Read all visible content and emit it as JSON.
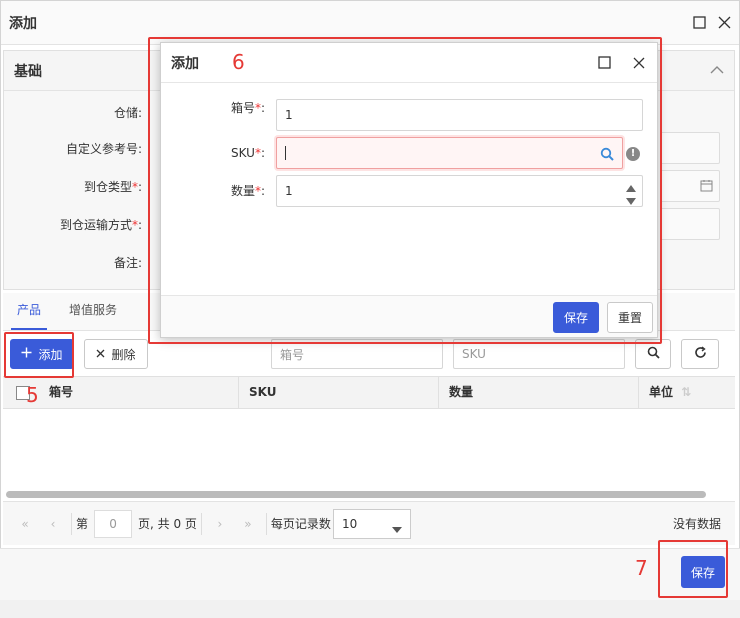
{
  "outer_dialog": {
    "title": "添加",
    "panel_title": "基础",
    "fields": [
      {
        "label": "仓储:",
        "required": false
      },
      {
        "label": "自定义参考号:",
        "required": false
      },
      {
        "label": "到仓类型",
        "required": true
      },
      {
        "label": "到仓运输方式",
        "required": true
      },
      {
        "label": "备注:",
        "required": false
      }
    ],
    "tabs": [
      "产品",
      "增值服务"
    ],
    "toolbar": {
      "add_label": "添加",
      "delete_label": "删除",
      "box_placeholder": "箱号",
      "sku_placeholder": "SKU"
    },
    "grid_columns": [
      "箱号",
      "SKU",
      "数量",
      "单位"
    ],
    "pager": {
      "page_prefix": "第",
      "page_value": "0",
      "page_suffix": "页, 共 0 页",
      "per_page_label": "每页记录数",
      "per_page_value": "10",
      "empty_text": "没有数据"
    },
    "save_label": "保存"
  },
  "inner_dialog": {
    "title": "添加",
    "fields": [
      {
        "label": "箱号",
        "value": "1"
      },
      {
        "label": "SKU",
        "value": ""
      },
      {
        "label": "数量",
        "value": "1"
      }
    ],
    "save_label": "保存",
    "reset_label": "重置"
  },
  "annotations": {
    "label_5": "5",
    "label_6": "6",
    "label_7": "7",
    "color": "#e53935"
  },
  "colors": {
    "primary": "#3a5bd9",
    "required": "#e33"
  }
}
